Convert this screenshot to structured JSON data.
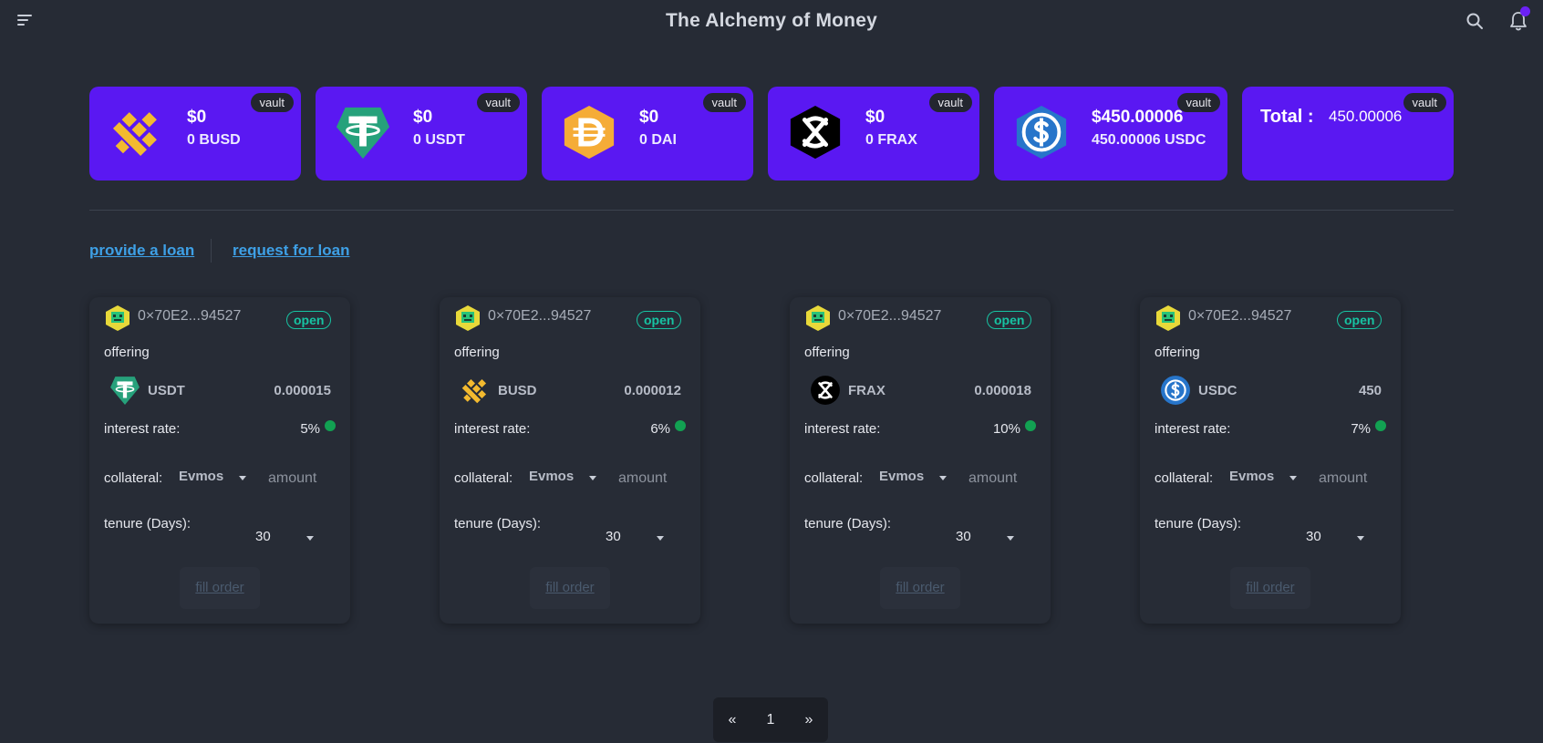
{
  "app": {
    "title": "The Alchemy of Money"
  },
  "header": {
    "menu_icon": "menu-icon",
    "search_icon": "search-icon",
    "bell_icon": "bell-icon"
  },
  "vaults": [
    {
      "badge": "vault",
      "amount": "$0",
      "sub": "0 BUSD",
      "icon": "busd-icon"
    },
    {
      "badge": "vault",
      "amount": "$0",
      "sub": "0 USDT",
      "icon": "usdt-icon"
    },
    {
      "badge": "vault",
      "amount": "$0",
      "sub": "0 DAI",
      "icon": "dai-icon"
    },
    {
      "badge": "vault",
      "amount": "$0",
      "sub": "0 FRAX",
      "icon": "frax-icon"
    },
    {
      "badge": "vault",
      "amount": "$450.00006",
      "sub": "450.00006 USDC",
      "icon": "usdc-icon"
    }
  ],
  "total": {
    "badge": "vault",
    "label": "Total :",
    "value": "450.00006"
  },
  "tabs": {
    "provide": "provide a loan",
    "request": "request for loan"
  },
  "loans": [
    {
      "address": "0×70E2...94527",
      "status": "open",
      "offering_label": "offering",
      "token": "USDT",
      "amount": "0.000015",
      "interest_label": "interest rate:",
      "interest": "5%",
      "collateral_label": "collateral:",
      "collateral": "Evmos",
      "amount_placeholder": "amount",
      "tenure_label": "tenure (Days):",
      "tenure": "30",
      "fill_label": "fill order"
    },
    {
      "address": "0×70E2...94527",
      "status": "open",
      "offering_label": "offering",
      "token": "BUSD",
      "amount": "0.000012",
      "interest_label": "interest rate:",
      "interest": "6%",
      "collateral_label": "collateral:",
      "collateral": "Evmos",
      "amount_placeholder": "amount",
      "tenure_label": "tenure (Days):",
      "tenure": "30",
      "fill_label": "fill order"
    },
    {
      "address": "0×70E2...94527",
      "status": "open",
      "offering_label": "offering",
      "token": "FRAX",
      "amount": "0.000018",
      "interest_label": "interest rate:",
      "interest": "10%",
      "collateral_label": "collateral:",
      "collateral": "Evmos",
      "amount_placeholder": "amount",
      "tenure_label": "tenure (Days):",
      "tenure": "30",
      "fill_label": "fill order"
    },
    {
      "address": "0×70E2...94527",
      "status": "open",
      "offering_label": "offering",
      "token": "USDC",
      "amount": "450",
      "interest_label": "interest rate:",
      "interest": "7%",
      "collateral_label": "collateral:",
      "collateral": "Evmos",
      "amount_placeholder": "amount",
      "tenure_label": "tenure (Days):",
      "tenure": "30",
      "fill_label": "fill order"
    }
  ],
  "pagination": {
    "prev": "«",
    "page": "1",
    "next": "»"
  },
  "colors": {
    "background": "#262b35",
    "accent": "#5a18f2",
    "link": "#3ea0e6",
    "status": "#17c3a2",
    "info": "#12a152"
  }
}
